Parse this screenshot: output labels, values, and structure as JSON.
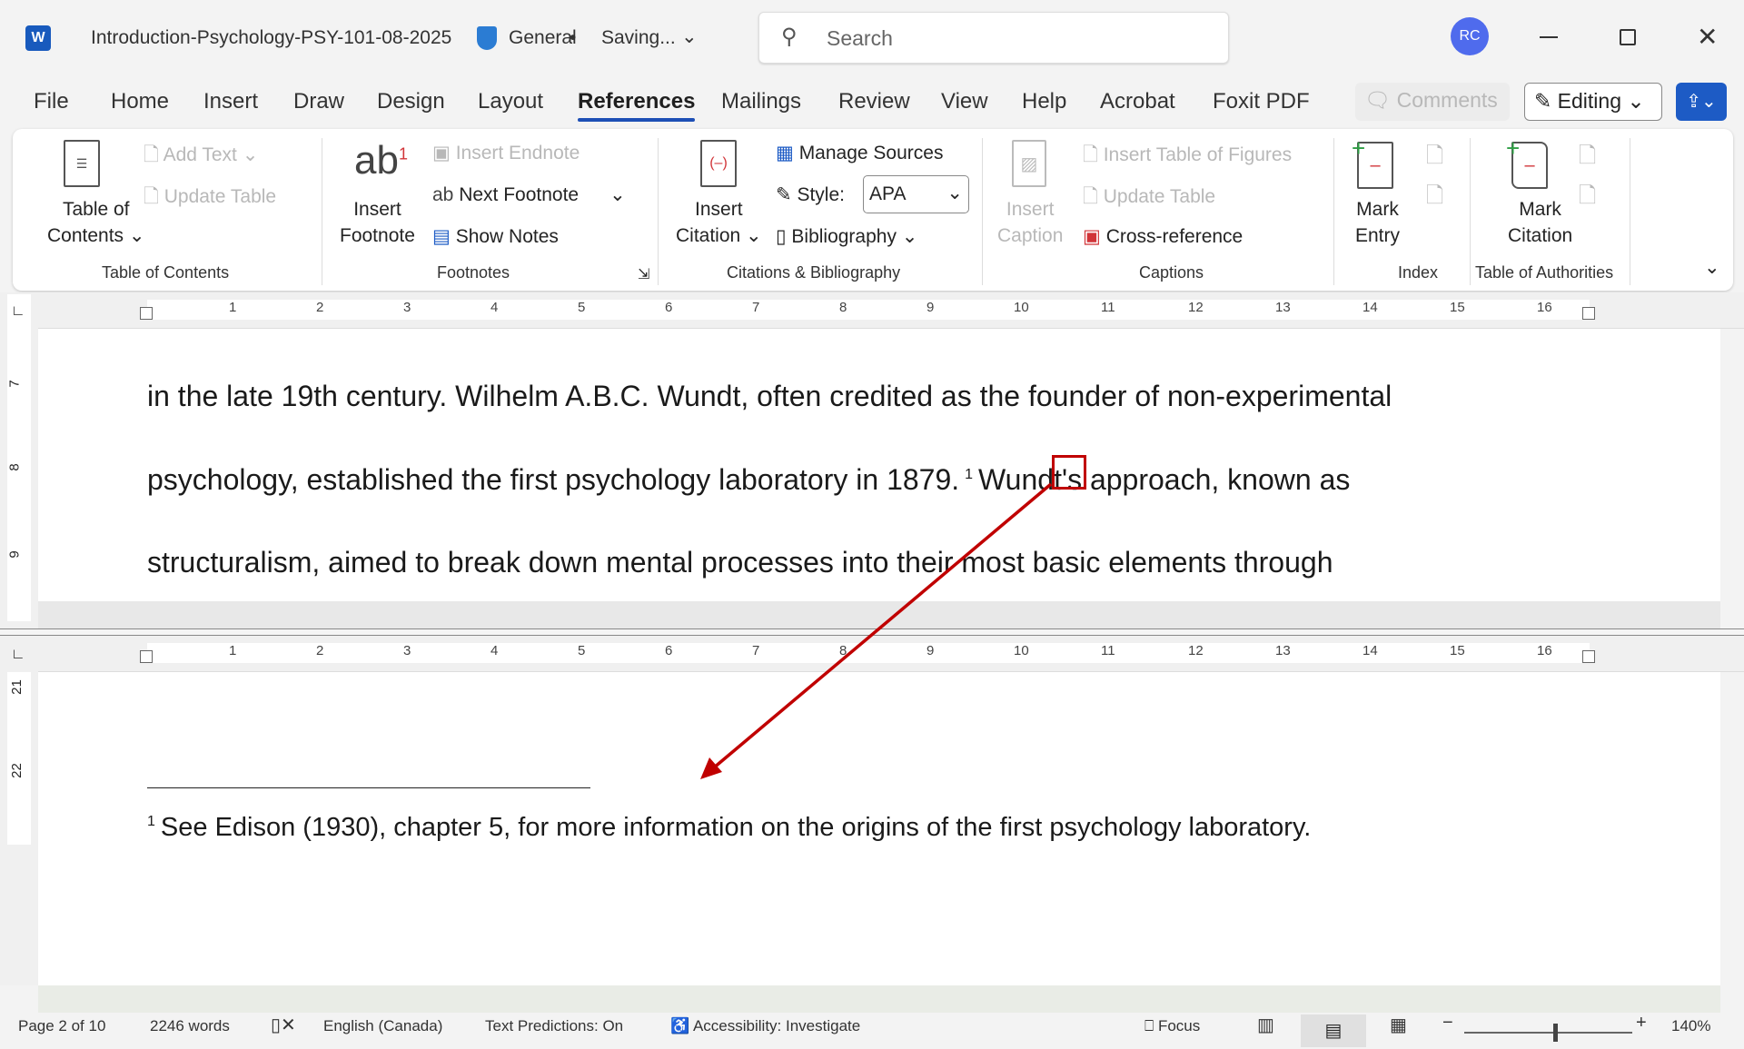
{
  "titlebar": {
    "doc_name": "Introduction-Psychology-PSY-101-08-2025",
    "sensitivity": "General",
    "save_status": "Saving...",
    "search_placeholder": "Search",
    "avatar": "RC"
  },
  "tabs": [
    "File",
    "Home",
    "Insert",
    "Draw",
    "Design",
    "Layout",
    "References",
    "Mailings",
    "Review",
    "View",
    "Help",
    "Acrobat",
    "Foxit PDF"
  ],
  "actions": {
    "comments": "Comments",
    "editing": "Editing"
  },
  "ribbon": {
    "toc": {
      "table_of_contents": [
        "Table of",
        "Contents"
      ],
      "add_text": "Add Text",
      "update_table": "Update Table",
      "group": "Table of Contents"
    },
    "footnotes": {
      "insert_footnote": [
        "Insert",
        "Footnote"
      ],
      "insert_endnote": "Insert Endnote",
      "next_footnote": "Next Footnote",
      "show_notes": "Show Notes",
      "group": "Footnotes"
    },
    "citations": {
      "insert_citation": [
        "Insert",
        "Citation"
      ],
      "manage_sources": "Manage Sources",
      "style_label": "Style:",
      "style_value": "APA",
      "bibliography": "Bibliography",
      "group": "Citations & Bibliography"
    },
    "captions": {
      "insert_caption": [
        "Insert",
        "Caption"
      ],
      "insert_table_of_figures": "Insert Table of Figures",
      "update_table": "Update Table",
      "cross_reference": "Cross-reference",
      "group": "Captions"
    },
    "index": {
      "mark_entry": [
        "Mark",
        "Entry"
      ],
      "group": "Index"
    },
    "authorities": {
      "mark_citation": [
        "Mark",
        "Citation"
      ],
      "group": "Table of Authorities"
    }
  },
  "ruler": {
    "h": [
      "1",
      "2",
      "3",
      "4",
      "5",
      "6",
      "7",
      "8",
      "9",
      "10",
      "11",
      "12",
      "13",
      "14",
      "15",
      "16"
    ],
    "v_top": [
      "7",
      "8",
      "9"
    ],
    "v_bottom": [
      "21",
      "22"
    ]
  },
  "document": {
    "lines": [
      "in the late 19th century. Wilhelm A.B.C. Wundt, often credited as the founder of non-experimental",
      "psychology, established the first psychology laboratory in 1879.",
      "Wundt's approach, known as",
      "structuralism, aimed to break down mental processes into their most basic elements through"
    ],
    "footnote_ref": "1",
    "footnote_number": "1",
    "footnote_text": "See Edison (1930), chapter 5, for more information on the origins of the first psychology laboratory."
  },
  "statusbar": {
    "page": "Page 2 of 10",
    "words": "2246 words",
    "language": "English (Canada)",
    "predictions": "Text Predictions: On",
    "accessibility": "Accessibility: Investigate",
    "focus": "Focus",
    "zoom": "140%"
  },
  "colors": {
    "accent": "#1d4fb5",
    "annotation": "#c00000",
    "avatar": "#4f6bed"
  }
}
